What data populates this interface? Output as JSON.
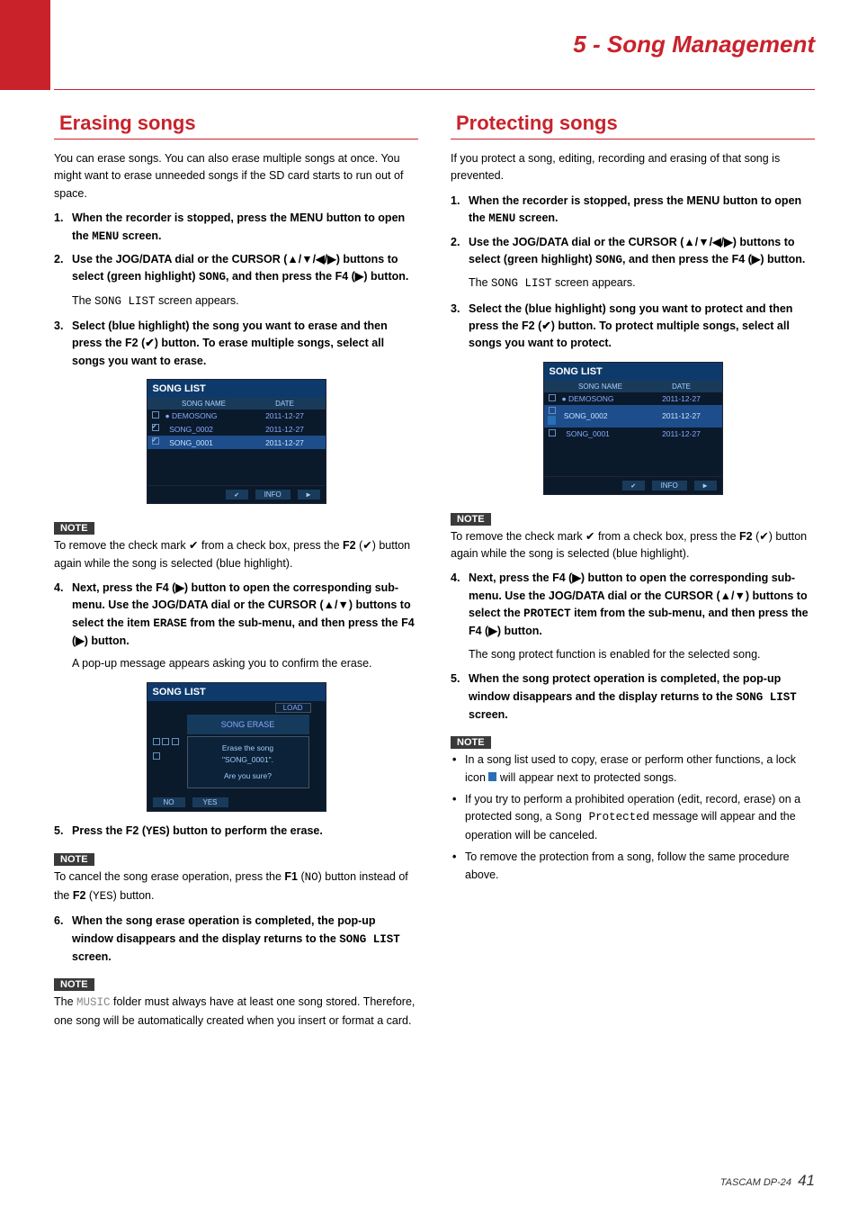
{
  "header": {
    "chapter": "5 - Song Management"
  },
  "left": {
    "h": "Erasing songs",
    "intro": "You can erase songs. You can also erase multiple songs at once. You might want to erase unneeded songs if the SD card starts to run out of space.",
    "s1_a": "When the recorder is stopped, press the MENU button to open the ",
    "s1_b": " screen.",
    "menu": "MENU",
    "s2_a": "Use the JOG/DATA dial or the CURSOR (▲/▼/◀/▶) buttons to select (green highlight) ",
    "song": "SONG",
    "s2_b": ", and then press the F4 (▶) button.",
    "s2_sub_a": "The ",
    "songlist": "SONG LIST",
    "s2_sub_b": " screen appears.",
    "s3": "Select (blue highlight) the song you want to erase and then press the F2 (✔) button. To erase multiple songs, select all songs you want to erase.",
    "note1": "To remove the check mark ✔ from a check box, press the ",
    "f2b": "F2",
    "note1b": " (✔) button again while the song is selected (blue highlight).",
    "s4_a": "Next, press the F4 (▶) button to open the corresponding sub-menu. Use the JOG/DATA dial or the CURSOR (▲/▼) buttons to select the item ",
    "erase": "ERASE",
    "s4_b": " from the sub-menu, and then press the F4 (▶) button.",
    "s4_sub": "A pop-up message appears asking you to confirm the erase.",
    "s5_a": "Press the F2 (",
    "yes": "YES",
    "s5_b": ") button to perform the erase.",
    "note2_a": "To cancel the song erase operation, press the ",
    "f1": "F1",
    "no": "NO",
    "note2_b": ") button instead of the ",
    "note2_c": ") button.",
    "s6_a": "When the song erase operation is completed, the pop-up window disappears and the display returns to the ",
    "s6_b": " screen.",
    "note3_a": "The ",
    "music": "MUSIC",
    "note3_b": " folder must always have at least one song stored. Therefore, one song will be automatically created when you insert or format a card.",
    "shot1": {
      "title": "SONG LIST",
      "col1": "SONG NAME",
      "col2": "DATE",
      "rows": [
        {
          "chk": false,
          "dot": true,
          "name": "DEMOSONG",
          "date": "2011-12-27",
          "sel": false
        },
        {
          "chk": true,
          "dot": false,
          "name": "SONG_0002",
          "date": "2011-12-27",
          "sel": false
        },
        {
          "chk": true,
          "dot": false,
          "name": "SONG_0001",
          "date": "2011-12-27",
          "sel": true
        }
      ],
      "ftick": "✔",
      "finfo": "INFO",
      "farr": "▶"
    },
    "shot2": {
      "title": "SONG LIST",
      "load": "LOAD",
      "center": "SONG ERASE",
      "line1": "Erase the song",
      "line2": "\"SONG_0001\".",
      "line3": "Are you sure?",
      "no": "NO",
      "yes": "YES"
    },
    "note_label": "NOTE"
  },
  "right": {
    "h": "Protecting songs",
    "intro": "If you protect a song, editing, recording and erasing of that song is prevented.",
    "s1_a": "When the recorder is stopped, press the MENU button to open the ",
    "s1_b": " screen.",
    "menu": "MENU",
    "s2_a": "Use the JOG/DATA dial or the CURSOR (▲/▼/◀/▶) buttons to select (green highlight) ",
    "song": "SONG",
    "s2_b": ", and then press the F4 (▶) button.",
    "s2_sub_a": "The ",
    "songlist": "SONG LIST",
    "s2_sub_b": " screen appears.",
    "s3": "Select the (blue highlight) song you want to protect and then press the F2 (✔) button. To protect multiple songs, select all songs you want to protect.",
    "note1": "To remove the check mark ✔ from a check box, press the ",
    "f2b": "F2",
    "note1b": " (✔) button again while the song is selected (blue highlight).",
    "s4_a": "Next, press the F4 (▶) button to open the corresponding sub-menu. Use the JOG/DATA dial or the CURSOR (▲/▼) buttons to select the ",
    "protect": "PROTECT",
    "s4_b": " item from the sub-menu, and then press the F4 (▶) button.",
    "s4_sub": "The song protect function is enabled for the selected song.",
    "s5_a": "When the song protect operation is completed, the pop-up window disappears and the display returns to the ",
    "s5_b": " screen.",
    "note2_b1": "In a song list used to copy, erase or perform other functions, a lock icon ",
    "note2_b1b": " will appear next to protected songs.",
    "note2_b2a": "If you try to perform a prohibited operation (edit, record, erase) on a protected song, a ",
    "songprot": "Song Protected",
    "note2_b2b": " message will appear and the operation will be canceled.",
    "note2_b3": "To remove the protection from a song, follow the same procedure above.",
    "shot": {
      "title": "SONG LIST",
      "col1": "SONG NAME",
      "col2": "DATE",
      "rows": [
        {
          "chk": false,
          "lock": false,
          "dot": true,
          "name": "DEMOSONG",
          "date": "2011-12-27",
          "sel": false
        },
        {
          "chk": false,
          "lock": true,
          "dot": false,
          "name": "SONG_0002",
          "date": "2011-12-27",
          "sel": true
        },
        {
          "chk": false,
          "lock": false,
          "dot": false,
          "name": "SONG_0001",
          "date": "2011-12-27",
          "sel": false
        }
      ],
      "ftick": "✔",
      "finfo": "INFO",
      "farr": "▶"
    },
    "note_label": "NOTE"
  },
  "footer": {
    "label": "TASCAM DP-24",
    "page": "41"
  }
}
